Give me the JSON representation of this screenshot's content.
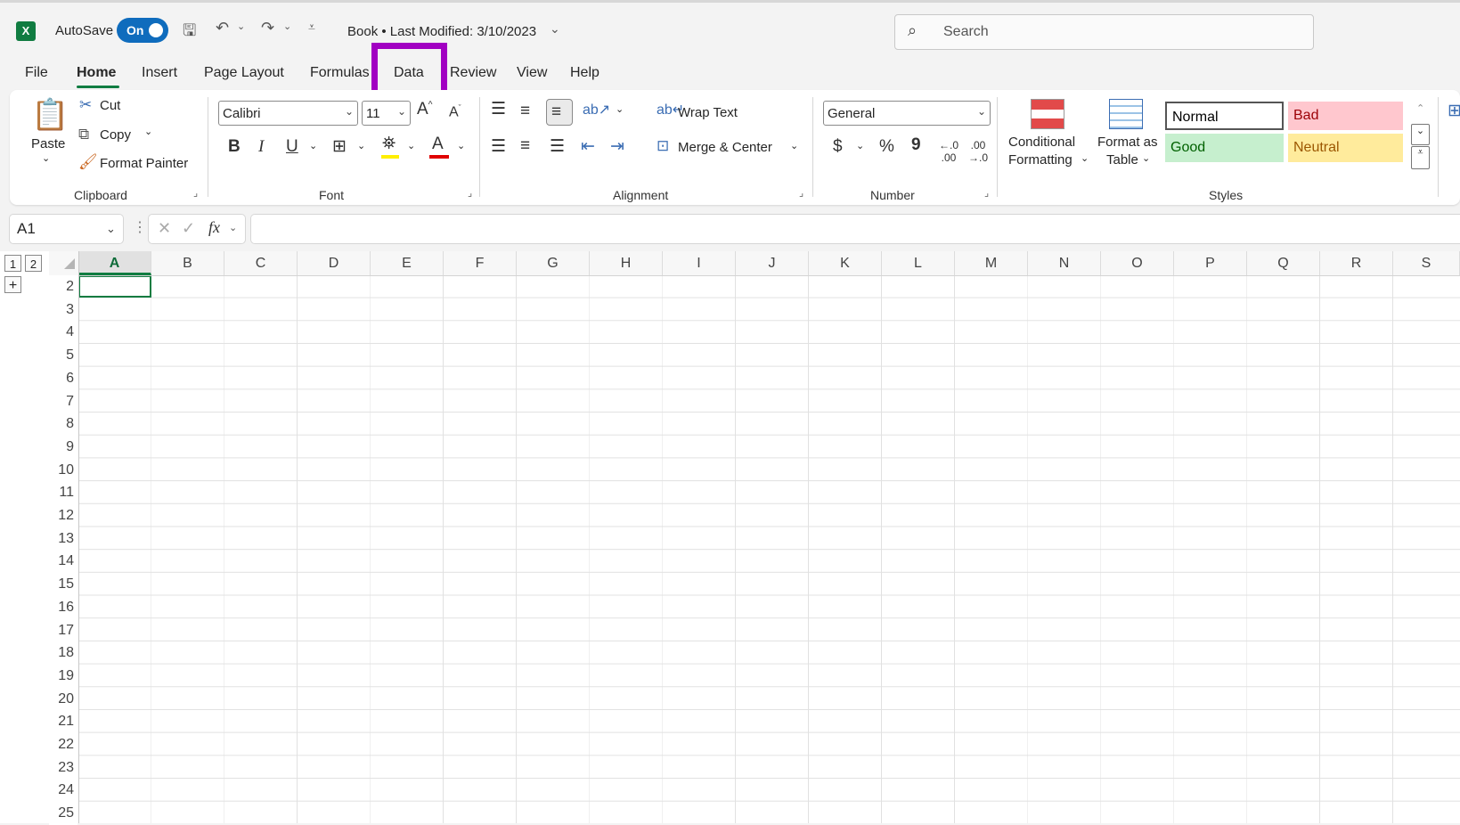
{
  "titlebar": {
    "autosave_label": "AutoSave",
    "autosave_state": "On",
    "document_title": "Book • Last Modified: 3/10/2023",
    "search_placeholder": "Search"
  },
  "tabs": [
    {
      "label": "File"
    },
    {
      "label": "Home"
    },
    {
      "label": "Insert"
    },
    {
      "label": "Page Layout"
    },
    {
      "label": "Formulas"
    },
    {
      "label": "Data"
    },
    {
      "label": "Review"
    },
    {
      "label": "View"
    },
    {
      "label": "Help"
    }
  ],
  "active_tab": "Home",
  "ribbon": {
    "clipboard": {
      "paste": "Paste",
      "cut": "Cut",
      "copy": "Copy",
      "format_painter": "Format Painter",
      "group": "Clipboard"
    },
    "font": {
      "name": "Calibri",
      "size": "11",
      "bold": "B",
      "italic": "I",
      "underline": "U",
      "group": "Font"
    },
    "alignment": {
      "wrap_text": "Wrap Text",
      "merge_center": "Merge & Center",
      "group": "Alignment"
    },
    "number": {
      "format": "General",
      "currency": "$",
      "percent": "%",
      "comma": "9",
      "group": "Number"
    },
    "styles": {
      "conditional_formatting_1": "Conditional",
      "conditional_formatting_2": "Formatting",
      "format_as_table_1": "Format as",
      "format_as_table_2": "Table",
      "normal": "Normal",
      "bad": "Bad",
      "good": "Good",
      "neutral": "Neutral",
      "group": "Styles"
    }
  },
  "formula_bar": {
    "name_box": "A1",
    "fx": "fx",
    "value": ""
  },
  "sheet": {
    "outline_levels": [
      "1",
      "2"
    ],
    "outline_expand": "+",
    "columns": [
      "A",
      "B",
      "C",
      "D",
      "E",
      "F",
      "G",
      "H",
      "I",
      "J",
      "K",
      "L",
      "M",
      "N",
      "O",
      "P",
      "Q",
      "R",
      "S"
    ],
    "rows": [
      "2",
      "3",
      "4",
      "5",
      "6",
      "7",
      "8",
      "9",
      "10",
      "11",
      "12",
      "13",
      "14",
      "15",
      "16",
      "17",
      "18",
      "19",
      "20",
      "21",
      "22",
      "23",
      "24",
      "25"
    ]
  },
  "colors": {
    "excel_green": "#107c41",
    "highlight": "#a100c2",
    "bad_fill": "#ffc7ce",
    "bad_text": "#9c0006",
    "good_fill": "#c6efce",
    "good_text": "#006100",
    "neutral_fill": "#ffeb9c",
    "neutral_text": "#9c5700"
  }
}
